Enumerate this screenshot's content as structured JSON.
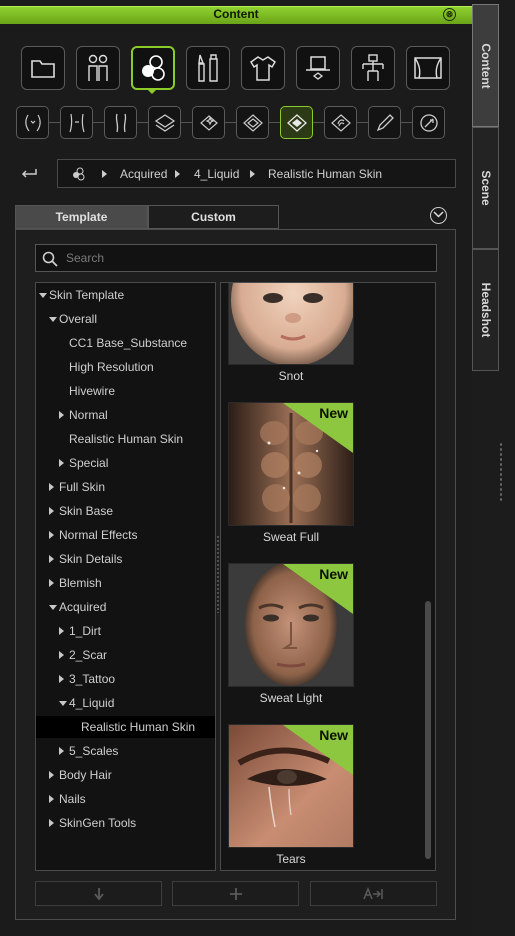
{
  "window": {
    "title": "Content",
    "close_label": "⊗"
  },
  "side_tabs": [
    {
      "label": "Content",
      "active": true
    },
    {
      "label": "Scene",
      "active": false
    },
    {
      "label": "Headshot",
      "active": false
    }
  ],
  "categories": [
    {
      "icon": "folder-icon"
    },
    {
      "icon": "characters-icon"
    },
    {
      "icon": "skin-material-icon",
      "active": true
    },
    {
      "icon": "makeup-brush-icon"
    },
    {
      "icon": "clothing-icon"
    },
    {
      "icon": "accessory-hat-icon"
    },
    {
      "icon": "pose-icon"
    },
    {
      "icon": "stage-icon"
    }
  ],
  "subcategories": [
    {
      "icon": "face-sculpt-icon"
    },
    {
      "icon": "body-sculpt-icon"
    },
    {
      "icon": "body-shape-icon"
    },
    {
      "icon": "layer-stack-icon"
    },
    {
      "icon": "sparkle-layer-icon"
    },
    {
      "icon": "diamond-layer-icon"
    },
    {
      "icon": "skin-layer-icon",
      "active": true
    },
    {
      "icon": "hair-layer-icon"
    },
    {
      "icon": "pen-icon"
    },
    {
      "icon": "globe-edit-icon"
    }
  ],
  "breadcrumb": {
    "icon": "skin-material-icon",
    "items": [
      "Acquired",
      "4_Liquid",
      "Realistic Human Skin"
    ]
  },
  "tabs": {
    "template": "Template",
    "custom": "Custom"
  },
  "search": {
    "placeholder": "Search",
    "value": ""
  },
  "tree": [
    {
      "label": "Skin Template",
      "level": 0,
      "state": "expanded"
    },
    {
      "label": "Overall",
      "level": 1,
      "state": "expanded"
    },
    {
      "label": "CC1 Base_Substance",
      "level": 2,
      "state": "leaf"
    },
    {
      "label": "High Resolution",
      "level": 2,
      "state": "leaf"
    },
    {
      "label": "Hivewire",
      "level": 2,
      "state": "leaf"
    },
    {
      "label": "Normal",
      "level": 2,
      "state": "collapsed"
    },
    {
      "label": "Realistic Human Skin",
      "level": 2,
      "state": "leaf"
    },
    {
      "label": "Special",
      "level": 2,
      "state": "collapsed"
    },
    {
      "label": "Full Skin",
      "level": 1,
      "state": "collapsed"
    },
    {
      "label": "Skin Base",
      "level": 1,
      "state": "collapsed"
    },
    {
      "label": "Normal Effects",
      "level": 1,
      "state": "collapsed"
    },
    {
      "label": "Skin Details",
      "level": 1,
      "state": "collapsed"
    },
    {
      "label": "Blemish",
      "level": 1,
      "state": "collapsed"
    },
    {
      "label": "Acquired",
      "level": 1,
      "state": "expanded"
    },
    {
      "label": "1_Dirt",
      "level": 2,
      "state": "collapsed"
    },
    {
      "label": "2_Scar",
      "level": 2,
      "state": "collapsed"
    },
    {
      "label": "3_Tattoo",
      "level": 2,
      "state": "collapsed"
    },
    {
      "label": "4_Liquid",
      "level": 2,
      "state": "expanded"
    },
    {
      "label": "Realistic Human Skin",
      "level": 3,
      "state": "leaf",
      "selected": true
    },
    {
      "label": "5_Scales",
      "level": 2,
      "state": "collapsed"
    },
    {
      "label": "Body Hair",
      "level": 1,
      "state": "collapsed"
    },
    {
      "label": "Nails",
      "level": 1,
      "state": "collapsed"
    },
    {
      "label": "SkinGen Tools",
      "level": 1,
      "state": "collapsed"
    }
  ],
  "items": [
    {
      "label": "Snot",
      "badge": "",
      "image": "baby-face-thumbnail"
    },
    {
      "label": "Sweat Full",
      "badge": "New",
      "image": "wet-abdomen-thumbnail"
    },
    {
      "label": "Sweat Light",
      "badge": "New",
      "image": "sweaty-face-thumbnail"
    },
    {
      "label": "Tears",
      "badge": "New",
      "image": "tearful-eye-thumbnail"
    }
  ],
  "bottom_actions": [
    {
      "icon": "download-icon"
    },
    {
      "icon": "add-icon"
    },
    {
      "icon": "apply-to-icon"
    }
  ],
  "colors": {
    "accent": "#8bcb2a",
    "badge": "#8dc63f",
    "background": "#1b1b1b"
  }
}
